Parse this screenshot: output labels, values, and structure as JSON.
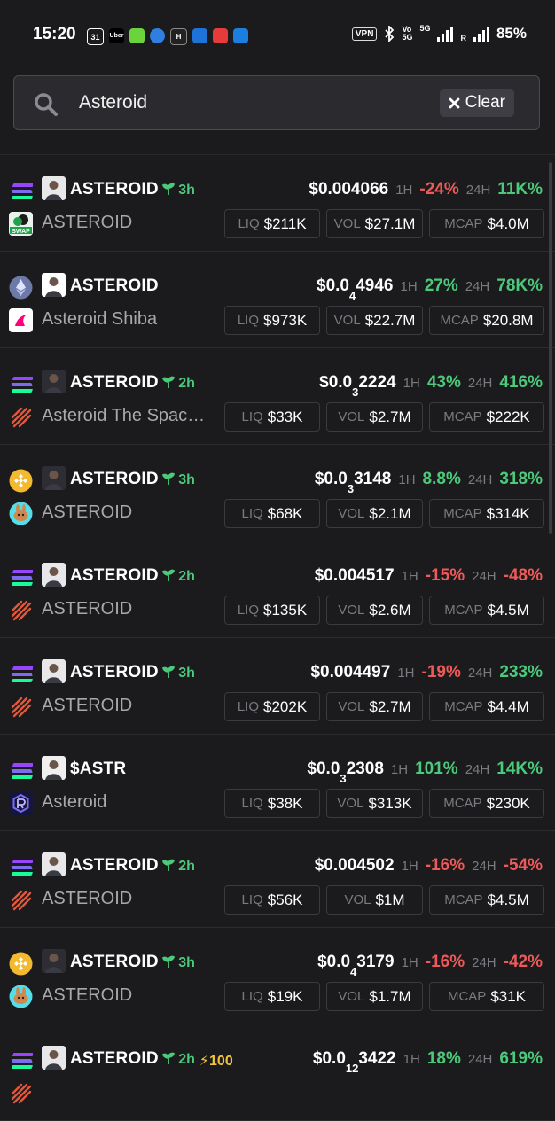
{
  "status": {
    "time": "15:20",
    "vpn": "VPN",
    "lte_top": "Vo",
    "lte_bottom": "5G",
    "net": "5G",
    "roaming": "R",
    "battery": "85%"
  },
  "search": {
    "query": "Asteroid",
    "clear_label": "Clear"
  },
  "labels": {
    "h1": "1H",
    "h24": "24H",
    "liq": "LIQ",
    "vol": "VOL",
    "mcap": "MCAP"
  },
  "colors": {
    "positive": "#4cc97a",
    "negative": "#ee5a5a",
    "background": "#1b1b1d"
  },
  "rows": [
    {
      "chain": "solana",
      "dex": "swap",
      "symbol": "ASTEROID",
      "age": "3h",
      "boost": "",
      "name": "ASTEROID",
      "price_main": "$0.004066",
      "price_zeros": "",
      "price_tail": "",
      "h1": "-24%",
      "h1_pos": false,
      "h24": "11K%",
      "h24_pos": true,
      "liq": "$211K",
      "vol": "$27.1M",
      "mcap": "$4.0M"
    },
    {
      "chain": "ethereum",
      "dex": "uniswap",
      "symbol": "ASTEROID",
      "age": "",
      "boost": "",
      "name": "Asteroid Shiba",
      "price_main": "$0.0",
      "price_zeros": "4",
      "price_tail": "4946",
      "h1": "27%",
      "h1_pos": true,
      "h24": "78K%",
      "h24_pos": true,
      "liq": "$973K",
      "vol": "$22.7M",
      "mcap": "$20.8M"
    },
    {
      "chain": "solana",
      "dex": "pumpfun",
      "symbol": "ASTEROID",
      "age": "2h",
      "boost": "",
      "name": "Asteroid The Spac…",
      "price_main": "$0.0",
      "price_zeros": "3",
      "price_tail": "2224",
      "h1": "43%",
      "h1_pos": true,
      "h24": "416%",
      "h24_pos": true,
      "liq": "$33K",
      "vol": "$2.7M",
      "mcap": "$222K"
    },
    {
      "chain": "bsc",
      "dex": "pancakeswap",
      "symbol": "ASTEROID",
      "age": "3h",
      "boost": "",
      "name": "ASTEROID",
      "price_main": "$0.0",
      "price_zeros": "3",
      "price_tail": "3148",
      "h1": "8.8%",
      "h1_pos": true,
      "h24": "318%",
      "h24_pos": true,
      "liq": "$68K",
      "vol": "$2.1M",
      "mcap": "$314K"
    },
    {
      "chain": "solana",
      "dex": "pumpfun",
      "symbol": "ASTEROID",
      "age": "2h",
      "boost": "",
      "name": "ASTEROID",
      "price_main": "$0.004517",
      "price_zeros": "",
      "price_tail": "",
      "h1": "-15%",
      "h1_pos": false,
      "h24": "-48%",
      "h24_pos": false,
      "liq": "$135K",
      "vol": "$2.6M",
      "mcap": "$4.5M"
    },
    {
      "chain": "solana",
      "dex": "pumpfun",
      "symbol": "ASTEROID",
      "age": "3h",
      "boost": "",
      "name": "ASTEROID",
      "price_main": "$0.004497",
      "price_zeros": "",
      "price_tail": "",
      "h1": "-19%",
      "h1_pos": false,
      "h24": "233%",
      "h24_pos": true,
      "liq": "$202K",
      "vol": "$2.7M",
      "mcap": "$4.4M"
    },
    {
      "chain": "solana",
      "dex": "raydium",
      "symbol": "$ASTR",
      "age": "",
      "boost": "",
      "name": "Asteroid",
      "price_main": "$0.0",
      "price_zeros": "3",
      "price_tail": "2308",
      "h1": "101%",
      "h1_pos": true,
      "h24": "14K%",
      "h24_pos": true,
      "liq": "$38K",
      "vol": "$313K",
      "mcap": "$230K"
    },
    {
      "chain": "solana",
      "dex": "pumpfun",
      "symbol": "ASTEROID",
      "age": "2h",
      "boost": "",
      "name": "ASTEROID",
      "price_main": "$0.004502",
      "price_zeros": "",
      "price_tail": "",
      "h1": "-16%",
      "h1_pos": false,
      "h24": "-54%",
      "h24_pos": false,
      "liq": "$56K",
      "vol": "$1M",
      "mcap": "$4.5M"
    },
    {
      "chain": "bsc",
      "dex": "pancakeswap",
      "symbol": "ASTEROID",
      "age": "3h",
      "boost": "",
      "name": "ASTEROID",
      "price_main": "$0.0",
      "price_zeros": "4",
      "price_tail": "3179",
      "h1": "-16%",
      "h1_pos": false,
      "h24": "-42%",
      "h24_pos": false,
      "liq": "$19K",
      "vol": "$1.7M",
      "mcap": "$31K"
    },
    {
      "chain": "solana",
      "dex": "pumpfun",
      "symbol": "ASTEROID",
      "age": "2h",
      "boost": "100",
      "name": "",
      "price_main": "$0.0",
      "price_zeros": "12",
      "price_tail": "3422",
      "h1": "18%",
      "h1_pos": true,
      "h24": "619%",
      "h24_pos": true,
      "liq": "",
      "vol": "",
      "mcap": ""
    }
  ]
}
